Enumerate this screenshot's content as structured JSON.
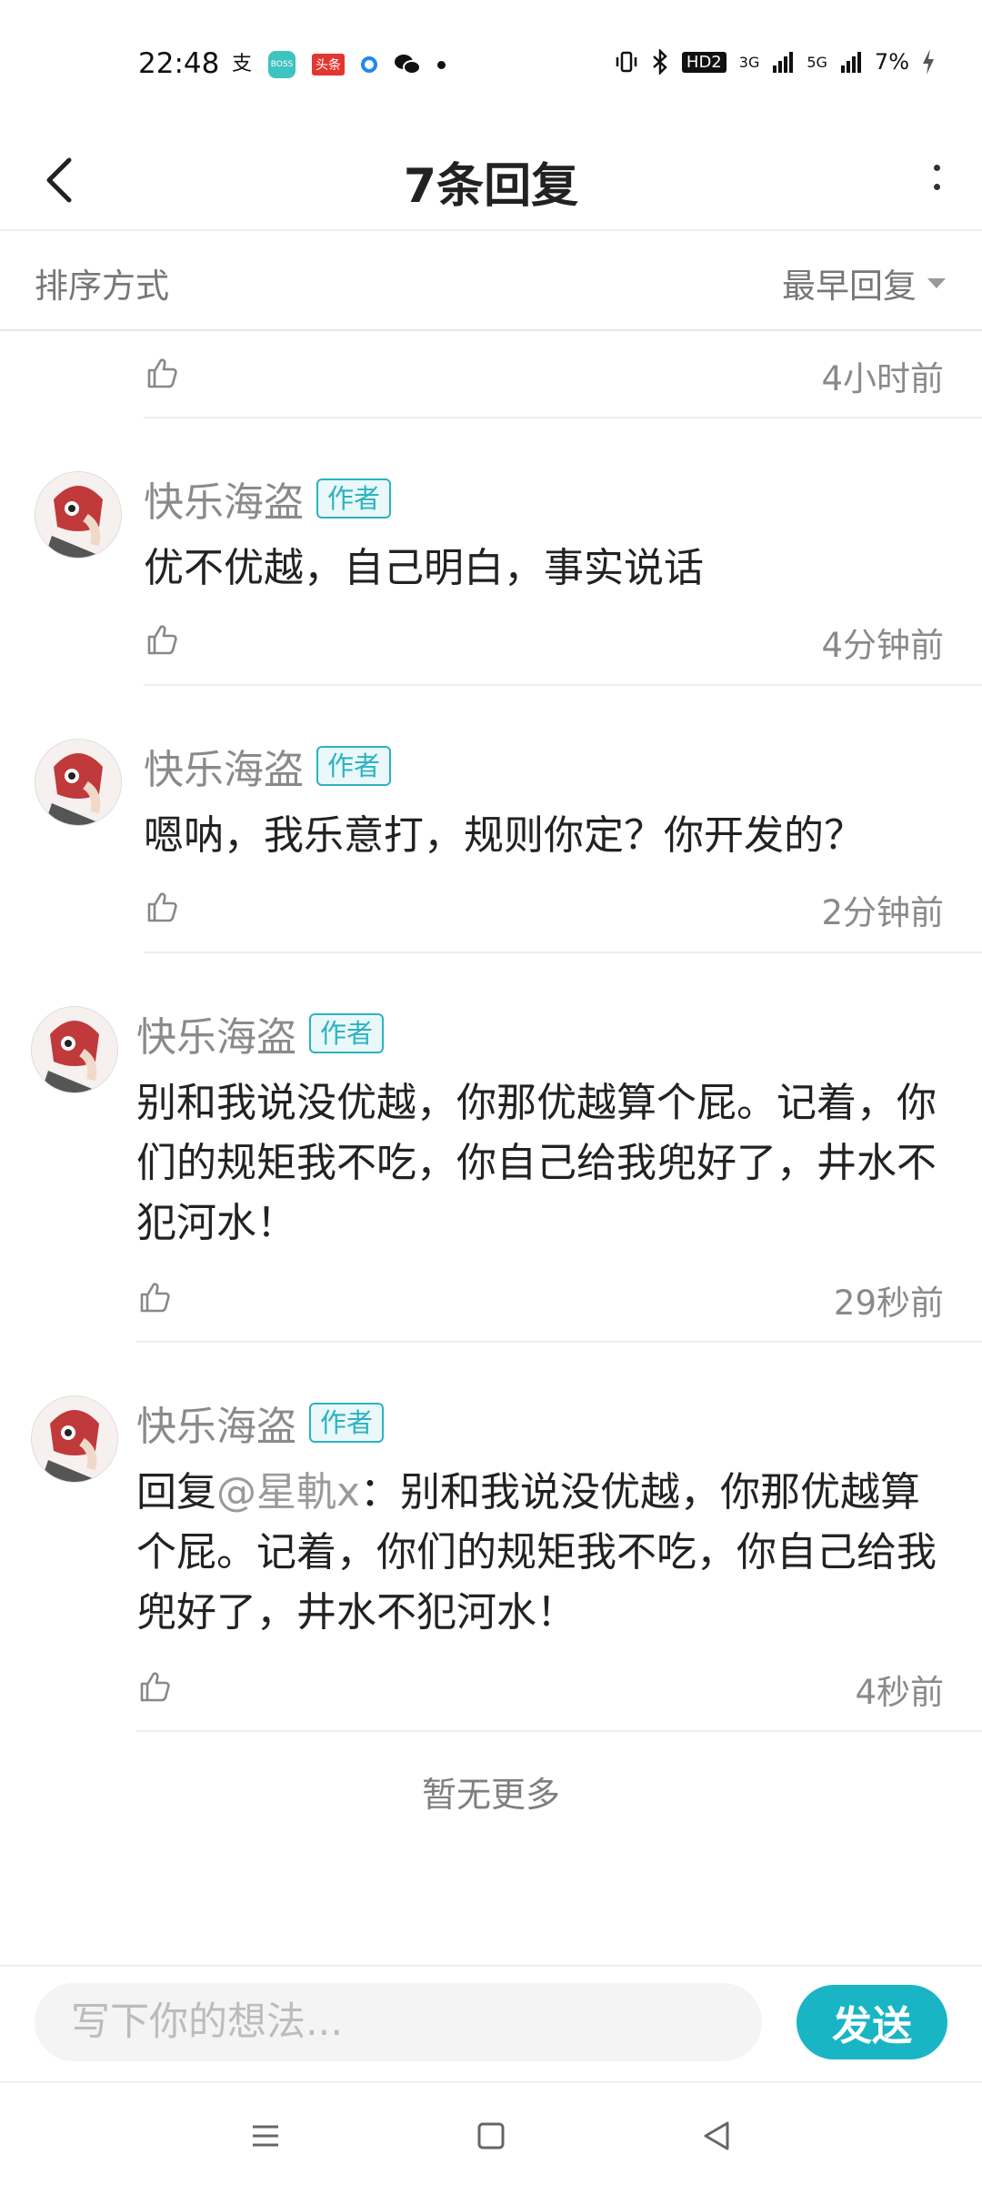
{
  "status_bar": {
    "time": "22:48",
    "app_icons": [
      "alipay-icon",
      "boss-icon",
      "toutiao-icon",
      "circle-app-icon",
      "wechat-icon",
      "dot-icon"
    ],
    "boss_text": "BOSS",
    "toutiao_text": "头条",
    "hd_text": "HD2",
    "network_1": "3G",
    "network_2": "5G",
    "battery": "7%"
  },
  "header": {
    "title": "7条回复"
  },
  "sort": {
    "label": "排序方式",
    "selected": "最早回复"
  },
  "partial_comment": {
    "time": "4小时前"
  },
  "comments": [
    {
      "author": "快乐海盗",
      "badge": "作者",
      "text": "优不优越，自己明白，事实说话",
      "time": "4分钟前"
    },
    {
      "author": "快乐海盗",
      "badge": "作者",
      "text": "嗯呐，我乐意打，规则你定？你开发的？",
      "time": "2分钟前"
    },
    {
      "author": "快乐海盗",
      "badge": "作者",
      "text": "别和我说没优越，你那优越算个屁。记着，你们的规矩我不吃，你自己给我兜好了，井水不犯河水！",
      "time": "29秒前"
    },
    {
      "author": "快乐海盗",
      "badge": "作者",
      "reply_prefix": "回复",
      "mention": "@星軌x",
      "text": "：别和我说没优越，你那优越算个屁。记着，你们的规矩我不吃，你自己给我兜好了，井水不犯河水！",
      "time": "4秒前"
    }
  ],
  "footer": {
    "no_more": "暂无更多"
  },
  "input_bar": {
    "placeholder": "写下你的想法...",
    "send_label": "发送"
  },
  "colors": {
    "accent": "#19b5c5",
    "badge": "#2bb3c0",
    "muted_text": "#8a8a8a"
  }
}
